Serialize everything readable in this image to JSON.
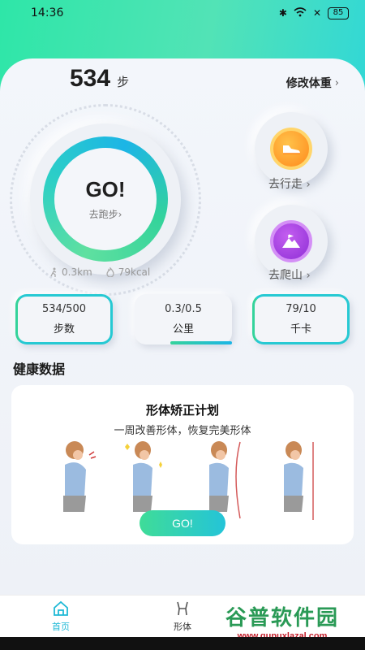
{
  "status_bar": {
    "time": "14:36",
    "battery": "85"
  },
  "header": {
    "steps_value": "534",
    "steps_unit": "步",
    "edit_weight": "修改体重"
  },
  "go_ring": {
    "title": "GO!",
    "subtitle": "去跑步"
  },
  "mini_stats": {
    "distance": "0.3km",
    "calories": "79kcal"
  },
  "actions": {
    "walk_label": "去行走",
    "climb_label": "去爬山"
  },
  "cards": [
    {
      "value": "534/500",
      "label": "步数"
    },
    {
      "value": "0.3/0.5",
      "label": "公里"
    },
    {
      "value": "79/10",
      "label": "千卡"
    }
  ],
  "health": {
    "section_title": "健康数据",
    "plan_title": "形体矫正计划",
    "plan_subtitle": "一周改善形体，恢复完美形体",
    "go_button": "GO!"
  },
  "nav": {
    "items": [
      {
        "label": "首页",
        "icon": "home-icon",
        "active": true
      },
      {
        "label": "形体",
        "icon": "body-icon",
        "active": false
      }
    ]
  },
  "colors": {
    "accent_green": "#34d39b",
    "accent_cyan": "#1cb5e6",
    "walk_orange": "#ff8a1c",
    "climb_purple": "#8e2fd6"
  }
}
